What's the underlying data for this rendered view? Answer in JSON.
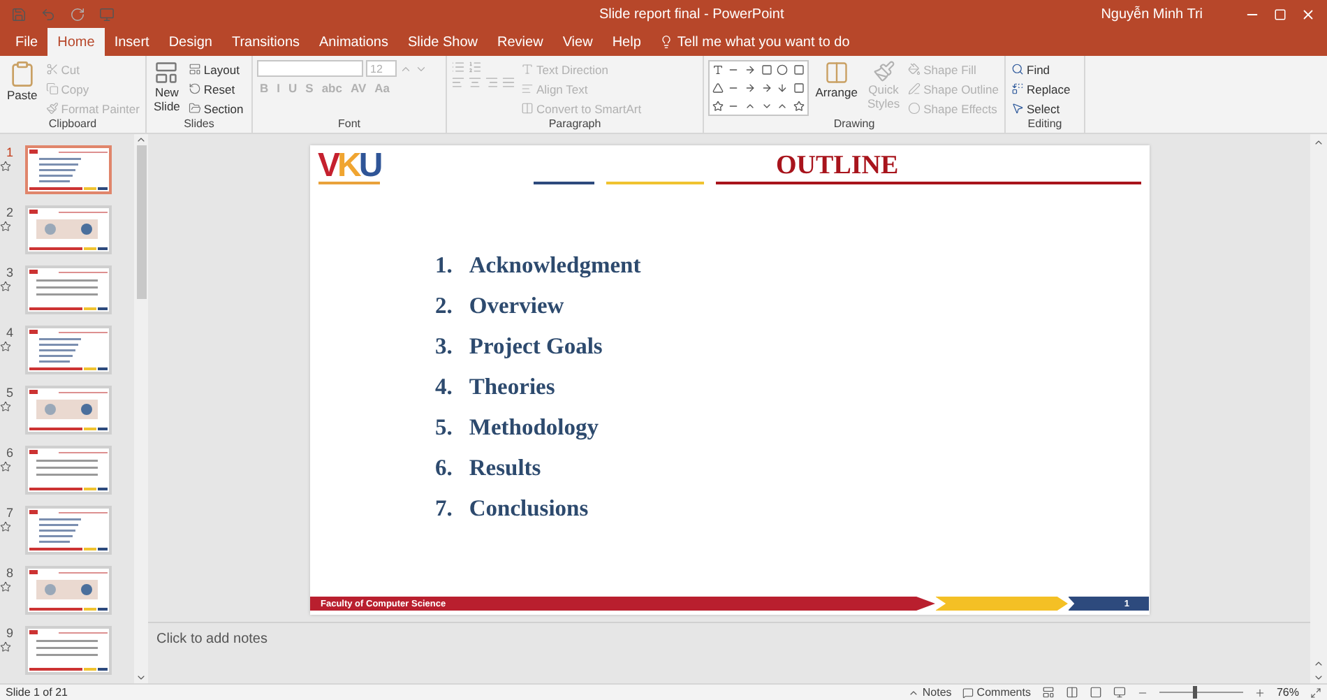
{
  "window": {
    "title": "Slide report final  -  PowerPoint",
    "user": "Nguyễn Minh Tri"
  },
  "tabs": [
    {
      "label": "File",
      "selected": false
    },
    {
      "label": "Home",
      "selected": true
    },
    {
      "label": "Insert",
      "selected": false
    },
    {
      "label": "Design",
      "selected": false
    },
    {
      "label": "Transitions",
      "selected": false
    },
    {
      "label": "Animations",
      "selected": false
    },
    {
      "label": "Slide Show",
      "selected": false
    },
    {
      "label": "Review",
      "selected": false
    },
    {
      "label": "View",
      "selected": false
    },
    {
      "label": "Help",
      "selected": false
    }
  ],
  "tell_me": "Tell me what you want to do",
  "ribbon": {
    "clipboard": {
      "label": "Clipboard",
      "paste": "Paste",
      "items": [
        {
          "label": "Cut",
          "disabled": true
        },
        {
          "label": "Copy",
          "disabled": true
        },
        {
          "label": "Format Painter",
          "disabled": true
        }
      ]
    },
    "slides": {
      "label": "Slides",
      "new_slide": [
        "New",
        "Slide"
      ],
      "items": [
        {
          "label": "Layout",
          "disabled": false
        },
        {
          "label": "Reset",
          "disabled": false
        },
        {
          "label": "Section",
          "disabled": false
        }
      ]
    },
    "font": {
      "label": "Font",
      "size": "12",
      "styles": [
        "B",
        "I",
        "U",
        "S",
        "abc",
        "AV",
        "Aa"
      ]
    },
    "paragraph": {
      "label": "Paragraph",
      "items": [
        {
          "label": "Text Direction",
          "disabled": true
        },
        {
          "label": "Align Text",
          "disabled": true
        },
        {
          "label": "Convert to SmartArt",
          "disabled": true
        }
      ]
    },
    "drawing": {
      "label": "Drawing",
      "arrange": "Arrange",
      "quick_styles": [
        "Quick",
        "Styles"
      ],
      "items": [
        {
          "label": "Shape Fill",
          "disabled": true
        },
        {
          "label": "Shape Outline",
          "disabled": true
        },
        {
          "label": "Shape Effects",
          "disabled": true
        }
      ]
    },
    "editing": {
      "label": "Editing",
      "items": [
        {
          "label": "Find",
          "disabled": false
        },
        {
          "label": "Replace",
          "disabled": false
        },
        {
          "label": "Select",
          "disabled": false
        }
      ]
    }
  },
  "thumbnails": [
    {
      "number": "1",
      "selected": true
    },
    {
      "number": "2",
      "selected": false
    },
    {
      "number": "3",
      "selected": false
    },
    {
      "number": "4",
      "selected": false
    },
    {
      "number": "5",
      "selected": false
    },
    {
      "number": "6",
      "selected": false
    },
    {
      "number": "7",
      "selected": false
    },
    {
      "number": "8",
      "selected": false
    },
    {
      "number": "9",
      "selected": false
    }
  ],
  "slide": {
    "logo": "VKU",
    "title": "OUTLINE",
    "items": [
      {
        "number": "1.",
        "text": "Acknowledgment"
      },
      {
        "number": "2.",
        "text": "Overview"
      },
      {
        "number": "3.",
        "text": "Project Goals"
      },
      {
        "number": "4.",
        "text": "Theories"
      },
      {
        "number": "5.",
        "text": "Methodology"
      },
      {
        "number": "6.",
        "text": "Results"
      },
      {
        "number": "7.",
        "text": "Conclusions"
      }
    ],
    "footer": "Faculty of Computer Science",
    "page": "1"
  },
  "notes_placeholder": "Click to add notes",
  "status_bar": {
    "slide_info": "Slide 1 of 21",
    "notes": "Notes",
    "comments": "Comments",
    "zoom": {
      "level": 0.4,
      "reading": "76%"
    }
  }
}
